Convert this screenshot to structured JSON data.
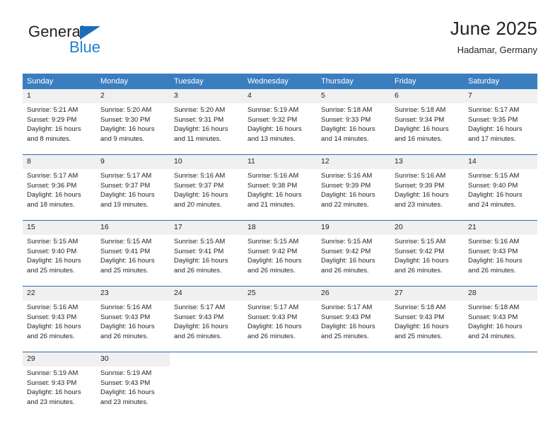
{
  "brand": {
    "name_part1": "General",
    "name_part2": "Blue",
    "logo_icon": "triangle-flag-icon"
  },
  "header": {
    "title": "June 2025",
    "location": "Hadamar, Germany"
  },
  "calendar": {
    "weekday_headers": [
      "Sunday",
      "Monday",
      "Tuesday",
      "Wednesday",
      "Thursday",
      "Friday",
      "Saturday"
    ],
    "weeks": [
      [
        {
          "day": "1",
          "details": "Sunrise: 5:21 AM\nSunset: 9:29 PM\nDaylight: 16 hours and 8 minutes."
        },
        {
          "day": "2",
          "details": "Sunrise: 5:20 AM\nSunset: 9:30 PM\nDaylight: 16 hours and 9 minutes."
        },
        {
          "day": "3",
          "details": "Sunrise: 5:20 AM\nSunset: 9:31 PM\nDaylight: 16 hours and 11 minutes."
        },
        {
          "day": "4",
          "details": "Sunrise: 5:19 AM\nSunset: 9:32 PM\nDaylight: 16 hours and 13 minutes."
        },
        {
          "day": "5",
          "details": "Sunrise: 5:18 AM\nSunset: 9:33 PM\nDaylight: 16 hours and 14 minutes."
        },
        {
          "day": "6",
          "details": "Sunrise: 5:18 AM\nSunset: 9:34 PM\nDaylight: 16 hours and 16 minutes."
        },
        {
          "day": "7",
          "details": "Sunrise: 5:17 AM\nSunset: 9:35 PM\nDaylight: 16 hours and 17 minutes."
        }
      ],
      [
        {
          "day": "8",
          "details": "Sunrise: 5:17 AM\nSunset: 9:36 PM\nDaylight: 16 hours and 18 minutes."
        },
        {
          "day": "9",
          "details": "Sunrise: 5:17 AM\nSunset: 9:37 PM\nDaylight: 16 hours and 19 minutes."
        },
        {
          "day": "10",
          "details": "Sunrise: 5:16 AM\nSunset: 9:37 PM\nDaylight: 16 hours and 20 minutes."
        },
        {
          "day": "11",
          "details": "Sunrise: 5:16 AM\nSunset: 9:38 PM\nDaylight: 16 hours and 21 minutes."
        },
        {
          "day": "12",
          "details": "Sunrise: 5:16 AM\nSunset: 9:39 PM\nDaylight: 16 hours and 22 minutes."
        },
        {
          "day": "13",
          "details": "Sunrise: 5:16 AM\nSunset: 9:39 PM\nDaylight: 16 hours and 23 minutes."
        },
        {
          "day": "14",
          "details": "Sunrise: 5:15 AM\nSunset: 9:40 PM\nDaylight: 16 hours and 24 minutes."
        }
      ],
      [
        {
          "day": "15",
          "details": "Sunrise: 5:15 AM\nSunset: 9:40 PM\nDaylight: 16 hours and 25 minutes."
        },
        {
          "day": "16",
          "details": "Sunrise: 5:15 AM\nSunset: 9:41 PM\nDaylight: 16 hours and 25 minutes."
        },
        {
          "day": "17",
          "details": "Sunrise: 5:15 AM\nSunset: 9:41 PM\nDaylight: 16 hours and 26 minutes."
        },
        {
          "day": "18",
          "details": "Sunrise: 5:15 AM\nSunset: 9:42 PM\nDaylight: 16 hours and 26 minutes."
        },
        {
          "day": "19",
          "details": "Sunrise: 5:15 AM\nSunset: 9:42 PM\nDaylight: 16 hours and 26 minutes."
        },
        {
          "day": "20",
          "details": "Sunrise: 5:15 AM\nSunset: 9:42 PM\nDaylight: 16 hours and 26 minutes."
        },
        {
          "day": "21",
          "details": "Sunrise: 5:16 AM\nSunset: 9:43 PM\nDaylight: 16 hours and 26 minutes."
        }
      ],
      [
        {
          "day": "22",
          "details": "Sunrise: 5:16 AM\nSunset: 9:43 PM\nDaylight: 16 hours and 26 minutes."
        },
        {
          "day": "23",
          "details": "Sunrise: 5:16 AM\nSunset: 9:43 PM\nDaylight: 16 hours and 26 minutes."
        },
        {
          "day": "24",
          "details": "Sunrise: 5:17 AM\nSunset: 9:43 PM\nDaylight: 16 hours and 26 minutes."
        },
        {
          "day": "25",
          "details": "Sunrise: 5:17 AM\nSunset: 9:43 PM\nDaylight: 16 hours and 26 minutes."
        },
        {
          "day": "26",
          "details": "Sunrise: 5:17 AM\nSunset: 9:43 PM\nDaylight: 16 hours and 25 minutes."
        },
        {
          "day": "27",
          "details": "Sunrise: 5:18 AM\nSunset: 9:43 PM\nDaylight: 16 hours and 25 minutes."
        },
        {
          "day": "28",
          "details": "Sunrise: 5:18 AM\nSunset: 9:43 PM\nDaylight: 16 hours and 24 minutes."
        }
      ],
      [
        {
          "day": "29",
          "details": "Sunrise: 5:19 AM\nSunset: 9:43 PM\nDaylight: 16 hours and 23 minutes."
        },
        {
          "day": "30",
          "details": "Sunrise: 5:19 AM\nSunset: 9:43 PM\nDaylight: 16 hours and 23 minutes."
        },
        {
          "day": "",
          "details": ""
        },
        {
          "day": "",
          "details": ""
        },
        {
          "day": "",
          "details": ""
        },
        {
          "day": "",
          "details": ""
        },
        {
          "day": "",
          "details": ""
        }
      ]
    ]
  },
  "colors": {
    "header_blue": "#3a7ebf",
    "row_divider_blue": "#2d6ca8",
    "daynum_band": "#f0f0f0",
    "brand_blue": "#1f7fd0",
    "logo_blue": "#1f6cb4",
    "text": "#231f20"
  }
}
